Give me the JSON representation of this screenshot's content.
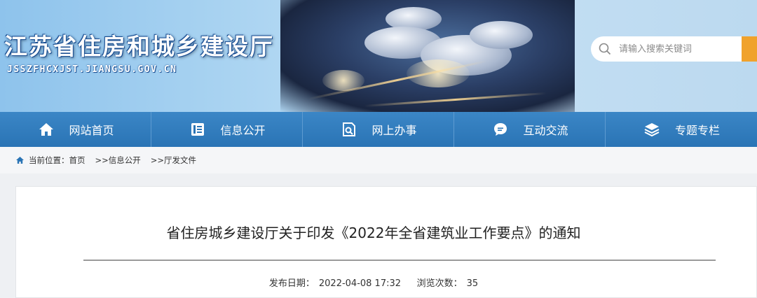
{
  "header": {
    "site_title": "江苏省住房和城乡建设厅",
    "site_domain": "JSSZFHCXJST.JIANGSU.GOV.CN"
  },
  "search": {
    "placeholder": "请输入搜索关键词",
    "icon": "search-icon"
  },
  "nav": {
    "items": [
      {
        "label": "网站首页",
        "icon": "home-icon"
      },
      {
        "label": "信息公开",
        "icon": "document-icon"
      },
      {
        "label": "网上办事",
        "icon": "search-doc-icon"
      },
      {
        "label": "互动交流",
        "icon": "chat-icon"
      },
      {
        "label": "专题专栏",
        "icon": "layers-icon"
      }
    ]
  },
  "breadcrumb": {
    "prefix": "当前位置：",
    "items": [
      "首页",
      ">>信息公开",
      ">>厅发文件"
    ]
  },
  "article": {
    "title": "省住房城乡建设厅关于印发《2022年全省建筑业工作要点》的通知",
    "publish_label": "发布日期：",
    "publish_date": "2022-04-08 17:32",
    "views_label": "浏览次数：",
    "views": "35"
  },
  "colors": {
    "nav_bg": "#2a74b5",
    "search_button": "#f0a22c"
  }
}
